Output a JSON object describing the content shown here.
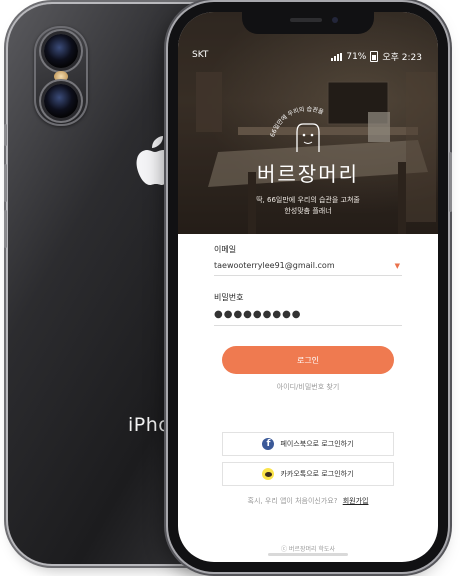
{
  "back_phone": {
    "model_text": "iPhone"
  },
  "status_bar": {
    "carrier": "SKT",
    "battery": "71%",
    "time": "오후 2:23"
  },
  "hero": {
    "logo_arc_text": "66일만에 우리의 습관을",
    "brand": "버르장머리",
    "tagline_line1": "딱, 66일만에 우리의 습관을 고쳐줄",
    "tagline_line2": "한성맞춤 플래너"
  },
  "form": {
    "email_label": "이메일",
    "email_value": "taewooterrylee91@gmail.com",
    "password_label": "비밀번호",
    "password_value": "●●●●●●●●●",
    "login_label": "로그인",
    "find_link": "아이디/비밀번호 찾기"
  },
  "social": {
    "facebook_label": "페이스북으로 로그인하기",
    "kakao_label": "카카오톡으로 로그인하기"
  },
  "signup": {
    "prompt": "혹시, 우리 앱이 처음이신가요?",
    "link": "회원가입"
  },
  "footer": "ⓒ 버르장머리 학도사",
  "colors": {
    "accent": "#ef7a50",
    "facebook": "#3b5998",
    "kakao": "#fbe44a"
  }
}
